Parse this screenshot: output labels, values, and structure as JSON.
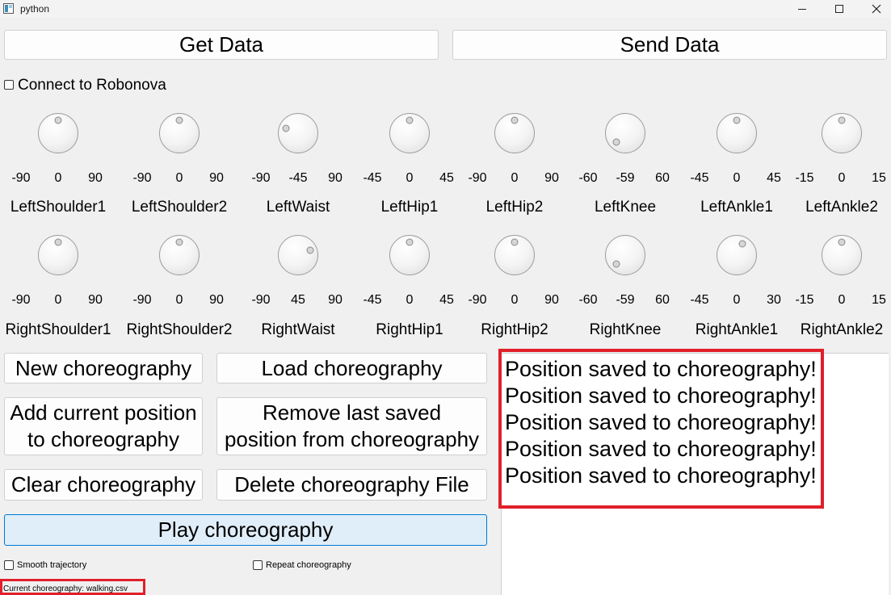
{
  "window": {
    "title": "python",
    "minimize_icon": "minimize-icon",
    "maximize_icon": "maximize-icon",
    "close_icon": "close-icon"
  },
  "toolbar": {
    "get_data": "Get Data",
    "send_data": "Send Data"
  },
  "connect": {
    "label": "Connect to Robonova",
    "checked": false
  },
  "joints_row1": [
    {
      "name": "LeftShoulder1",
      "min": "-90",
      "val": "0",
      "max": "90",
      "value_fraction": 0.5
    },
    {
      "name": "LeftShoulder2",
      "min": "-90",
      "val": "0",
      "max": "90",
      "value_fraction": 0.5
    },
    {
      "name": "LeftWaist",
      "min": "-90",
      "val": "-45",
      "max": "90",
      "value_fraction": 0.25
    },
    {
      "name": "LeftHip1",
      "min": "-45",
      "val": "0",
      "max": "45",
      "value_fraction": 0.5
    },
    {
      "name": "LeftHip2",
      "min": "-90",
      "val": "0",
      "max": "90",
      "value_fraction": 0.5
    },
    {
      "name": "LeftKnee",
      "min": "-60",
      "val": "-59",
      "max": "60",
      "value_fraction": 0.0
    },
    {
      "name": "LeftAnkle1",
      "min": "-45",
      "val": "0",
      "max": "45",
      "value_fraction": 0.5
    },
    {
      "name": "LeftAnkle2",
      "min": "-15",
      "val": "0",
      "max": "15",
      "value_fraction": 0.5
    }
  ],
  "joints_row2": [
    {
      "name": "RightShoulder1",
      "min": "-90",
      "val": "0",
      "max": "90",
      "value_fraction": 0.5
    },
    {
      "name": "RightShoulder2",
      "min": "-90",
      "val": "0",
      "max": "90",
      "value_fraction": 0.5
    },
    {
      "name": "RightWaist",
      "min": "-90",
      "val": "45",
      "max": "90",
      "value_fraction": 0.75
    },
    {
      "name": "RightHip1",
      "min": "-45",
      "val": "0",
      "max": "45",
      "value_fraction": 0.5
    },
    {
      "name": "RightHip2",
      "min": "-90",
      "val": "0",
      "max": "90",
      "value_fraction": 0.5
    },
    {
      "name": "RightKnee",
      "min": "-60",
      "val": "-59",
      "max": "60",
      "value_fraction": 0.0
    },
    {
      "name": "RightAnkle1",
      "min": "-45",
      "val": "0",
      "max": "30",
      "value_fraction": 0.6
    },
    {
      "name": "RightAnkle2",
      "min": "-15",
      "val": "0",
      "max": "15",
      "value_fraction": 0.5
    }
  ],
  "actions": {
    "new": "New choreography",
    "load": "Load choreography",
    "add": "Add current position\nto choreography",
    "remove": "Remove last saved\nposition from choreography",
    "clear": "Clear choreography",
    "delete": "Delete choreography File",
    "play": "Play choreography"
  },
  "options": {
    "smooth_label": "Smooth trajectory",
    "smooth_checked": false,
    "repeat_label": "Repeat choreography",
    "repeat_checked": false
  },
  "log": [
    "Position saved to choreography!",
    "Position saved to choreography!",
    "Position saved to choreography!",
    "Position saved to choreography!",
    "Position saved to choreography!"
  ],
  "status": {
    "current": "Current choreography: walking.csv"
  },
  "colors": {
    "highlight": "#e0202a",
    "play_bg": "#e0eef9",
    "play_border": "#0078d4"
  }
}
